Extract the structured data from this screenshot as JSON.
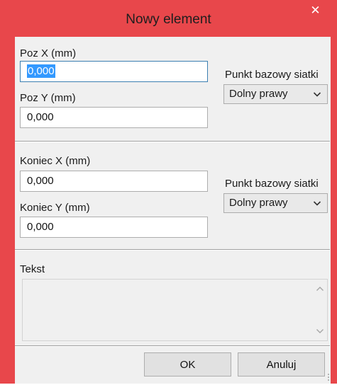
{
  "window": {
    "title": "Nowy element"
  },
  "start": {
    "x_label": "Poz X (mm)",
    "x_value": "0,000",
    "y_label": "Poz Y (mm)",
    "y_value": "0,000",
    "base_label": "Punkt bazowy siatki",
    "base_value": "Dolny prawy"
  },
  "end": {
    "x_label": "Koniec X (mm)",
    "x_value": "0,000",
    "y_label": "Koniec Y (mm)",
    "y_value": "0,000",
    "base_label": "Punkt bazowy siatki",
    "base_value": "Dolny prawy"
  },
  "text": {
    "label": "Tekst",
    "value": ""
  },
  "buttons": {
    "ok": "OK",
    "cancel": "Anuluj"
  },
  "icons": {
    "close": "close-icon",
    "chevron": "chevron-down-icon",
    "scroll_up": "chevron-up-icon",
    "scroll_down": "chevron-down-icon"
  },
  "colors": {
    "titlebar": "#e8474b",
    "client": "#f0f0f0",
    "focus_border": "#3c7fb1",
    "selection": "#3399ff"
  }
}
